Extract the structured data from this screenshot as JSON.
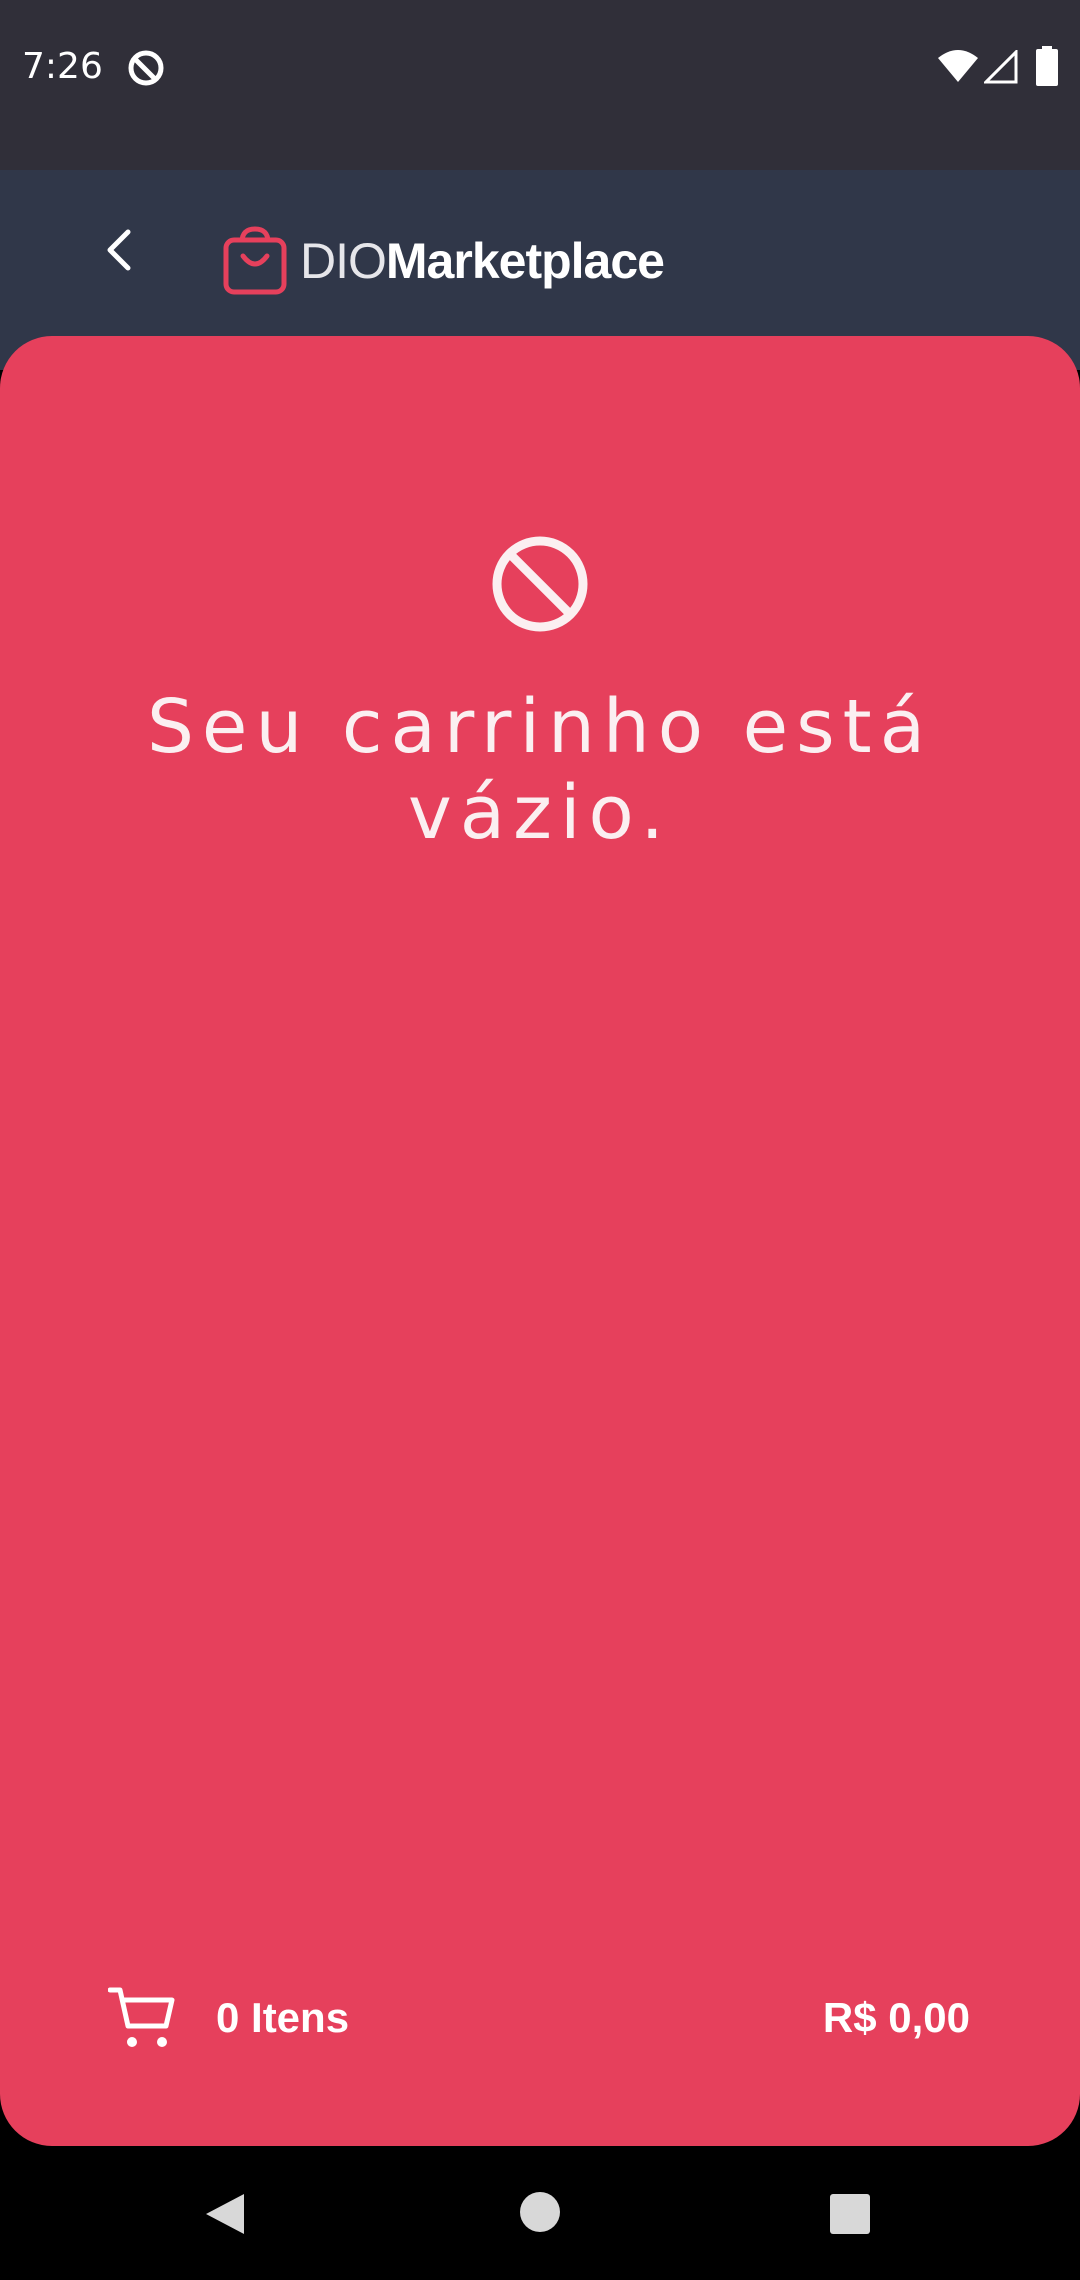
{
  "status_bar": {
    "time": "7:26",
    "icons": [
      "do-not-disturb-icon",
      "wifi-icon",
      "signal-icon",
      "battery-icon"
    ]
  },
  "app_bar": {
    "back_icon": "chevron-left-icon",
    "logo": {
      "icon": "shopping-bag-icon",
      "text_light": "DIO",
      "text_bold": "Marketplace"
    }
  },
  "cart": {
    "empty_icon": "prohibited-icon",
    "empty_message": "Seu carrinho está vázio.",
    "cart_icon": "shopping-cart-icon",
    "item_count": "0 Itens",
    "total": "R$ 0,00"
  },
  "nav_bar": {
    "icons": [
      "back-triangle-icon",
      "home-circle-icon",
      "recents-square-icon"
    ]
  },
  "colors": {
    "status_bar_bg": "#302f39",
    "app_bar_bg": "#303749",
    "card_bg": "#e6405c",
    "logo_accent": "#e6405c",
    "nav_bar_bg": "#000000"
  }
}
